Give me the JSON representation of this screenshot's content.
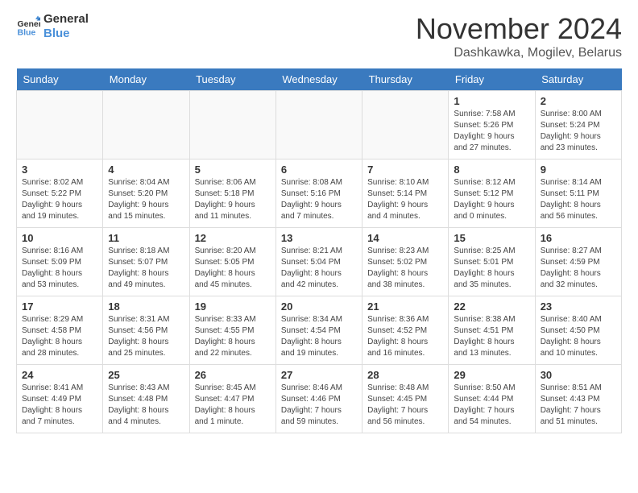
{
  "header": {
    "logo_line1": "General",
    "logo_line2": "Blue",
    "month_title": "November 2024",
    "location": "Dashkawka, Mogilev, Belarus"
  },
  "weekdays": [
    "Sunday",
    "Monday",
    "Tuesday",
    "Wednesday",
    "Thursday",
    "Friday",
    "Saturday"
  ],
  "weeks": [
    [
      {
        "day": "",
        "info": ""
      },
      {
        "day": "",
        "info": ""
      },
      {
        "day": "",
        "info": ""
      },
      {
        "day": "",
        "info": ""
      },
      {
        "day": "",
        "info": ""
      },
      {
        "day": "1",
        "info": "Sunrise: 7:58 AM\nSunset: 5:26 PM\nDaylight: 9 hours and 27 minutes."
      },
      {
        "day": "2",
        "info": "Sunrise: 8:00 AM\nSunset: 5:24 PM\nDaylight: 9 hours and 23 minutes."
      }
    ],
    [
      {
        "day": "3",
        "info": "Sunrise: 8:02 AM\nSunset: 5:22 PM\nDaylight: 9 hours and 19 minutes."
      },
      {
        "day": "4",
        "info": "Sunrise: 8:04 AM\nSunset: 5:20 PM\nDaylight: 9 hours and 15 minutes."
      },
      {
        "day": "5",
        "info": "Sunrise: 8:06 AM\nSunset: 5:18 PM\nDaylight: 9 hours and 11 minutes."
      },
      {
        "day": "6",
        "info": "Sunrise: 8:08 AM\nSunset: 5:16 PM\nDaylight: 9 hours and 7 minutes."
      },
      {
        "day": "7",
        "info": "Sunrise: 8:10 AM\nSunset: 5:14 PM\nDaylight: 9 hours and 4 minutes."
      },
      {
        "day": "8",
        "info": "Sunrise: 8:12 AM\nSunset: 5:12 PM\nDaylight: 9 hours and 0 minutes."
      },
      {
        "day": "9",
        "info": "Sunrise: 8:14 AM\nSunset: 5:11 PM\nDaylight: 8 hours and 56 minutes."
      }
    ],
    [
      {
        "day": "10",
        "info": "Sunrise: 8:16 AM\nSunset: 5:09 PM\nDaylight: 8 hours and 53 minutes."
      },
      {
        "day": "11",
        "info": "Sunrise: 8:18 AM\nSunset: 5:07 PM\nDaylight: 8 hours and 49 minutes."
      },
      {
        "day": "12",
        "info": "Sunrise: 8:20 AM\nSunset: 5:05 PM\nDaylight: 8 hours and 45 minutes."
      },
      {
        "day": "13",
        "info": "Sunrise: 8:21 AM\nSunset: 5:04 PM\nDaylight: 8 hours and 42 minutes."
      },
      {
        "day": "14",
        "info": "Sunrise: 8:23 AM\nSunset: 5:02 PM\nDaylight: 8 hours and 38 minutes."
      },
      {
        "day": "15",
        "info": "Sunrise: 8:25 AM\nSunset: 5:01 PM\nDaylight: 8 hours and 35 minutes."
      },
      {
        "day": "16",
        "info": "Sunrise: 8:27 AM\nSunset: 4:59 PM\nDaylight: 8 hours and 32 minutes."
      }
    ],
    [
      {
        "day": "17",
        "info": "Sunrise: 8:29 AM\nSunset: 4:58 PM\nDaylight: 8 hours and 28 minutes."
      },
      {
        "day": "18",
        "info": "Sunrise: 8:31 AM\nSunset: 4:56 PM\nDaylight: 8 hours and 25 minutes."
      },
      {
        "day": "19",
        "info": "Sunrise: 8:33 AM\nSunset: 4:55 PM\nDaylight: 8 hours and 22 minutes."
      },
      {
        "day": "20",
        "info": "Sunrise: 8:34 AM\nSunset: 4:54 PM\nDaylight: 8 hours and 19 minutes."
      },
      {
        "day": "21",
        "info": "Sunrise: 8:36 AM\nSunset: 4:52 PM\nDaylight: 8 hours and 16 minutes."
      },
      {
        "day": "22",
        "info": "Sunrise: 8:38 AM\nSunset: 4:51 PM\nDaylight: 8 hours and 13 minutes."
      },
      {
        "day": "23",
        "info": "Sunrise: 8:40 AM\nSunset: 4:50 PM\nDaylight: 8 hours and 10 minutes."
      }
    ],
    [
      {
        "day": "24",
        "info": "Sunrise: 8:41 AM\nSunset: 4:49 PM\nDaylight: 8 hours and 7 minutes."
      },
      {
        "day": "25",
        "info": "Sunrise: 8:43 AM\nSunset: 4:48 PM\nDaylight: 8 hours and 4 minutes."
      },
      {
        "day": "26",
        "info": "Sunrise: 8:45 AM\nSunset: 4:47 PM\nDaylight: 8 hours and 1 minute."
      },
      {
        "day": "27",
        "info": "Sunrise: 8:46 AM\nSunset: 4:46 PM\nDaylight: 7 hours and 59 minutes."
      },
      {
        "day": "28",
        "info": "Sunrise: 8:48 AM\nSunset: 4:45 PM\nDaylight: 7 hours and 56 minutes."
      },
      {
        "day": "29",
        "info": "Sunrise: 8:50 AM\nSunset: 4:44 PM\nDaylight: 7 hours and 54 minutes."
      },
      {
        "day": "30",
        "info": "Sunrise: 8:51 AM\nSunset: 4:43 PM\nDaylight: 7 hours and 51 minutes."
      }
    ]
  ]
}
